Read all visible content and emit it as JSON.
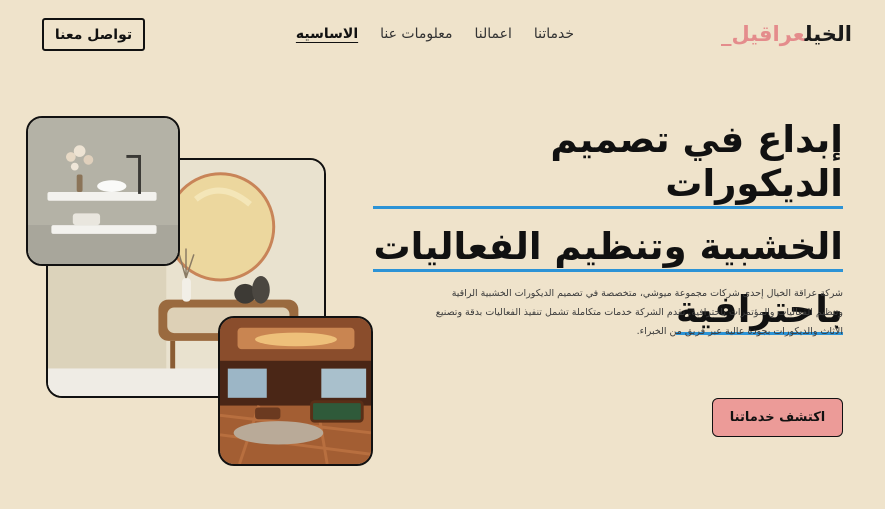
{
  "header": {
    "logo_part1": "عراقيل_",
    "logo_part2": "الخيل",
    "nav": [
      {
        "label": "الاساسيه",
        "active": true
      },
      {
        "label": "معلومات عنا",
        "active": false
      },
      {
        "label": "اعمالنا",
        "active": false
      },
      {
        "label": "خدماتنا",
        "active": false
      }
    ],
    "contact_label": "تواصل معنا"
  },
  "hero": {
    "title_lines": [
      "إبداع في تصميم الديكورات",
      "الخشبية وتنظيم الفعاليات",
      "باحترافية"
    ],
    "description": "شركة عراقة الخيال إحدى شركات مجموعة ميوشي، متخصصة في تصميم الديكورات الخشبية الراقية وتنظيم الفعاليات والمؤتمرات باحترافية. تقدم الشركة خدمات متكاملة تشمل تنفيذ الفعاليات بدقة وتصنيع الأثاث والديكورات بجودة عالية عبر فريق من الخبراء.",
    "cta_label": "اكتشف خدماتنا"
  },
  "colors": {
    "background": "#efe3cb",
    "accent_pink": "#ec9b98",
    "underline_blue": "#2c93d6"
  }
}
